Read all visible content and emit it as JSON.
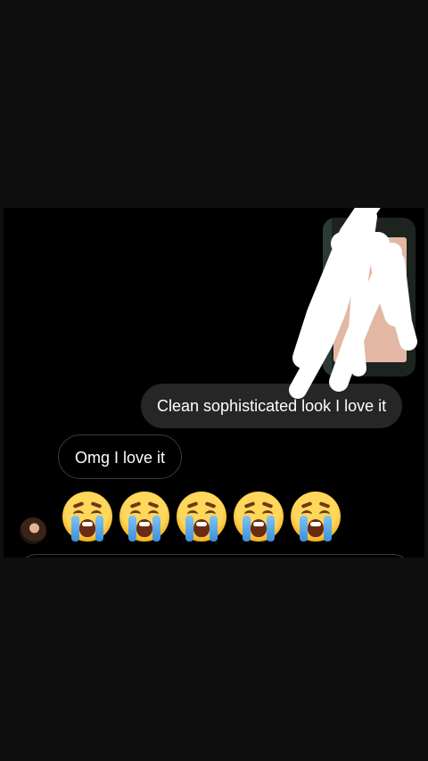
{
  "conversation": {
    "sent_message": "Clean sophisticated look I love it",
    "received_message": "Omg I love it",
    "emoji_reaction": [
      "loudly-crying-face-icon",
      "loudly-crying-face-icon",
      "loudly-crying-face-icon",
      "loudly-crying-face-icon",
      "loudly-crying-face-icon"
    ]
  },
  "colors": {
    "background": "#0f0f0f",
    "chat_background": "#000000",
    "sent_bubble": "#262626",
    "received_bubble_border": "#3a3a3a",
    "scribble": "#ffffff"
  }
}
